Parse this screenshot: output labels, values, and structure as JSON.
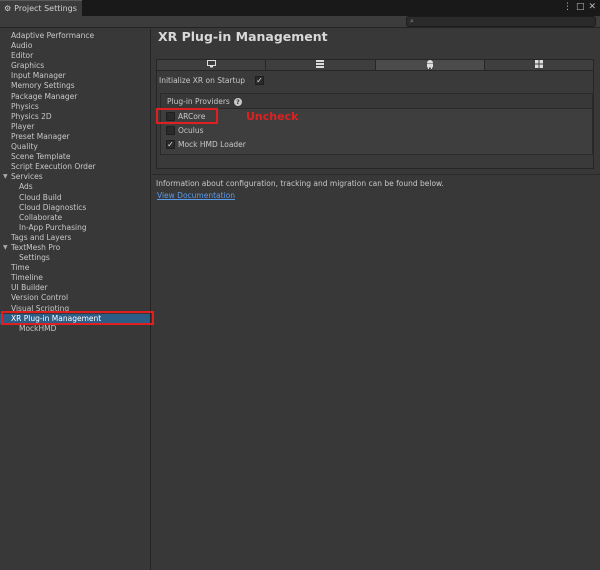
{
  "window": {
    "title": "Project Settings",
    "title_icon": "gear-icon",
    "menu_icon": "⋮",
    "maximize_icon": "□",
    "close_icon": "✕"
  },
  "search": {
    "icon": "search-icon",
    "placeholder": "",
    "value": ""
  },
  "sidebar": {
    "items": [
      {
        "label": "Adaptive Performance",
        "level": 0
      },
      {
        "label": "Audio",
        "level": 0
      },
      {
        "label": "Editor",
        "level": 0
      },
      {
        "label": "Graphics",
        "level": 0
      },
      {
        "label": "Input Manager",
        "level": 0
      },
      {
        "label": "Memory Settings",
        "level": 0
      },
      {
        "label": "Package Manager",
        "level": 0
      },
      {
        "label": "Physics",
        "level": 0
      },
      {
        "label": "Physics 2D",
        "level": 0
      },
      {
        "label": "Player",
        "level": 0
      },
      {
        "label": "Preset Manager",
        "level": 0
      },
      {
        "label": "Quality",
        "level": 0
      },
      {
        "label": "Scene Template",
        "level": 0
      },
      {
        "label": "Script Execution Order",
        "level": 0
      },
      {
        "label": "Services",
        "level": 0,
        "group": true
      },
      {
        "label": "Ads",
        "level": 1
      },
      {
        "label": "Cloud Build",
        "level": 1
      },
      {
        "label": "Cloud Diagnostics",
        "level": 1
      },
      {
        "label": "Collaborate",
        "level": 1
      },
      {
        "label": "In-App Purchasing",
        "level": 1
      },
      {
        "label": "Tags and Layers",
        "level": 0
      },
      {
        "label": "TextMesh Pro",
        "level": 0,
        "group": true
      },
      {
        "label": "Settings",
        "level": 1
      },
      {
        "label": "Time",
        "level": 0
      },
      {
        "label": "Timeline",
        "level": 0
      },
      {
        "label": "UI Builder",
        "level": 0
      },
      {
        "label": "Version Control",
        "level": 0
      },
      {
        "label": "Visual Scripting",
        "level": 0
      },
      {
        "label": "XR Plug-in Management",
        "level": 0,
        "selected": true
      },
      {
        "label": "MockHMD",
        "level": 1
      }
    ]
  },
  "main": {
    "title": "XR Plug-in Management",
    "tabs": [
      {
        "icon": "monitor-icon",
        "glyph": "🖵",
        "active": false
      },
      {
        "icon": "server-icon",
        "glyph": "≣",
        "active": false
      },
      {
        "icon": "android-icon",
        "glyph": "🤖",
        "active": true
      },
      {
        "icon": "windows-icon",
        "glyph": "⊞",
        "active": false
      }
    ],
    "init_label": "Initialize XR on Startup",
    "init_checked": true,
    "providers_label": "Plug-in Providers",
    "providers": [
      {
        "label": "ARCore",
        "checked": false
      },
      {
        "label": "Oculus",
        "checked": false
      },
      {
        "label": "Mock HMD Loader",
        "checked": true
      }
    ],
    "annotation": "Uncheck",
    "info_text": "Information about configuration, tracking and migration can be found below.",
    "doc_link": "View Documentation"
  },
  "colors": {
    "annotation_red": "#e02020",
    "selection_blue": "#2c5d87",
    "link_blue": "#5b9ae8"
  }
}
